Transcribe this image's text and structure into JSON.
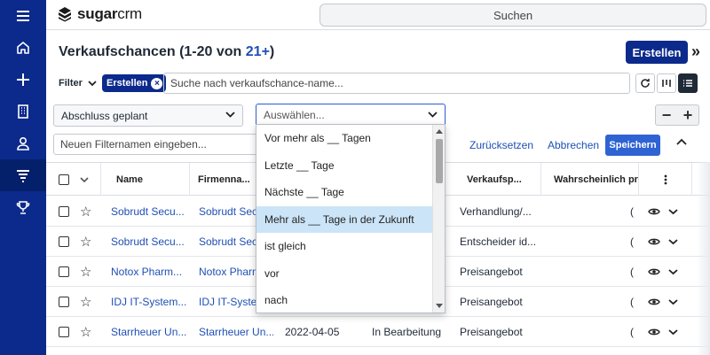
{
  "brand": {
    "logo_text_bold": "sugar",
    "logo_text_rest": "crm"
  },
  "search": {
    "placeholder": "Suchen"
  },
  "header": {
    "title_prefix": "Verkaufschancen (1-20 von ",
    "title_count": "21+",
    "title_suffix": ")",
    "create_label": "Erstellen",
    "expand_icon": "»"
  },
  "filter": {
    "label": "Filter",
    "pill_label": "Erstellen",
    "search_placeholder": "Suche nach verkaufschance-name...",
    "field_select": "Abschluss geplant",
    "operator_placeholder": "Auswählen...",
    "filtername_placeholder": "Neuen Filternamen eingeben...",
    "reset_label": "Zurücksetzen",
    "cancel_label": "Abbrechen",
    "save_label": "Speichern",
    "minus": "−",
    "plus": "+"
  },
  "dropdown": {
    "options": [
      "Vor mehr als __ Tagen",
      "Letzte __ Tage",
      "Nächste __ Tage",
      "Mehr als __ Tage in der Zukunft",
      "ist gleich",
      "vor",
      "nach"
    ],
    "highlighted_index": 3
  },
  "table": {
    "columns": [
      "Name",
      "Firmenna...",
      "Verkaufsp...",
      "Wahrscheinlich pro"
    ],
    "rows": [
      {
        "name": "Sobrudt Secu...",
        "account": "Sobrudt Secu...",
        "date": "",
        "status": "",
        "stage": "Verhandlung/...",
        "prob": "("
      },
      {
        "name": "Sobrudt Secu...",
        "account": "Sobrudt Secu...",
        "date": "",
        "status": "",
        "stage": "Entscheider id...",
        "prob": "("
      },
      {
        "name": "Notox Pharm...",
        "account": "Notox Pharm",
        "date": "",
        "status": "",
        "stage": "Preisangebot",
        "prob": "("
      },
      {
        "name": "IDJ IT-System...",
        "account": "IDJ IT-Systen",
        "date": "",
        "status": "",
        "stage": "Preisangebot",
        "prob": "("
      },
      {
        "name": "Starrheuer Un...",
        "account": "Starrheuer Un...",
        "date": "2022-04-05",
        "status": "In Bearbeitung",
        "stage": "Preisangebot",
        "prob": "("
      }
    ]
  },
  "colors": {
    "sidebar": "#0b2a8c",
    "primary": "#0b2a8c",
    "link": "#1f4fb5",
    "highlight": "#cce4f7"
  }
}
